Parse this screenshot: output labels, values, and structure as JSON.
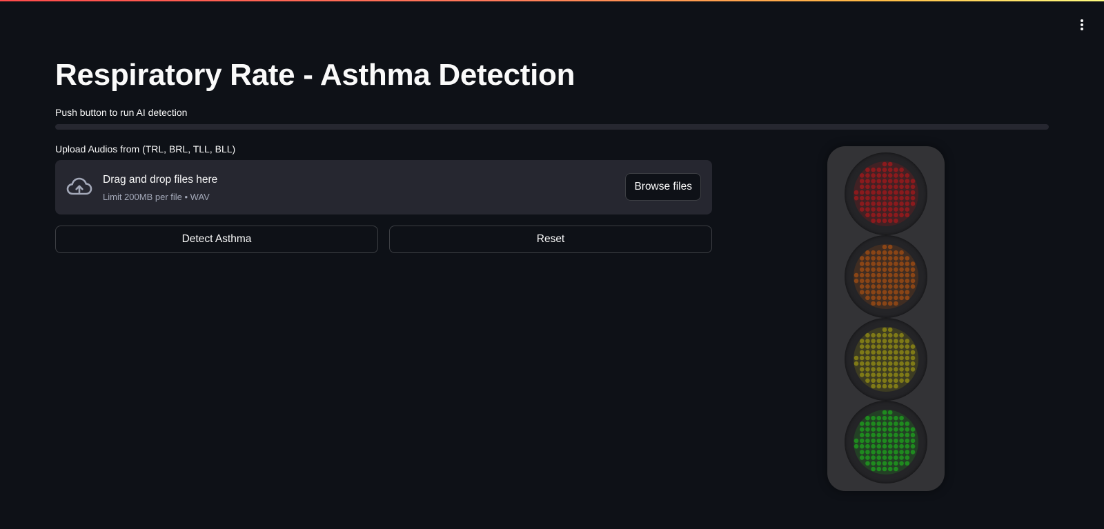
{
  "app": {
    "menu_icon": "vertical-ellipsis-icon",
    "decoration_colors": [
      "#ff4b4b",
      "#ffbd45",
      "#fffd80"
    ]
  },
  "header": {
    "title": "Respiratory Rate - Asthma Detection"
  },
  "progress": {
    "label": "Push button to run AI detection",
    "value": 0
  },
  "uploader": {
    "label": "Upload Audios from (TRL, BRL, TLL, BLL)",
    "icon": "cloud-upload-icon",
    "drop_title": "Drag and drop files here",
    "drop_subtitle": "Limit 200MB per file • WAV",
    "browse_label": "Browse files"
  },
  "actions": {
    "detect_label": "Detect Asthma",
    "reset_label": "Reset"
  },
  "traffic_light": {
    "lamps": [
      {
        "name": "red",
        "color": "#8b1a1d",
        "on": false
      },
      {
        "name": "orange",
        "color": "#8a4516",
        "on": false
      },
      {
        "name": "yellow",
        "color": "#7f7a17",
        "on": false
      },
      {
        "name": "green",
        "color": "#1f8a1f",
        "on": false
      }
    ]
  }
}
